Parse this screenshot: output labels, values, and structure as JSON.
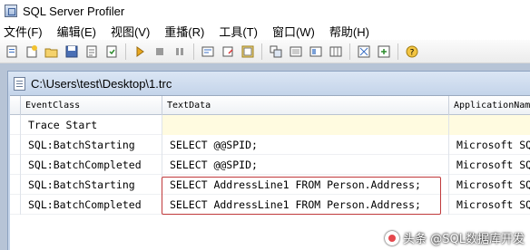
{
  "app": {
    "title": "SQL Server Profiler",
    "icon": "profiler-app-icon"
  },
  "menu": [
    {
      "label": "文件(F)"
    },
    {
      "label": "编辑(E)"
    },
    {
      "label": "视图(V)"
    },
    {
      "label": "重播(R)"
    },
    {
      "label": "工具(T)"
    },
    {
      "label": "窗口(W)"
    },
    {
      "label": "帮助(H)"
    }
  ],
  "toolbar": {
    "buttons": [
      "new-trace-icon",
      "new-template-icon",
      "open-icon",
      "save-icon",
      "properties-icon",
      "template-props-icon",
      "run-icon",
      "stop-icon",
      "pause-icon",
      "find-icon",
      "clear-icon",
      "extract-icon",
      "collapse-icon",
      "expand-icon",
      "group-icon",
      "columns-icon",
      "auto-scroll-icon",
      "settings-icon",
      "help-icon"
    ]
  },
  "trace_window": {
    "title": "C:\\Users\\test\\Desktop\\1.trc",
    "columns": [
      "EventClass",
      "TextData",
      "ApplicationNam"
    ],
    "rows": [
      {
        "event": "Trace Start",
        "text": "",
        "app": ""
      },
      {
        "event": "SQL:BatchStarting",
        "text": "SELECT @@SPID;",
        "app": "Microsoft SQ"
      },
      {
        "event": "SQL:BatchCompleted",
        "text": "SELECT @@SPID;",
        "app": "Microsoft SQ"
      },
      {
        "event": "SQL:BatchStarting",
        "text": "SELECT AddressLine1 FROM Person.Address;",
        "app": "Microsoft SQ"
      },
      {
        "event": "SQL:BatchCompleted",
        "text": "SELECT AddressLine1 FROM Person.Address;",
        "app": "Microsoft SQ"
      }
    ]
  },
  "colors": {
    "highlight_border": "#c0393b",
    "mdi_background": "#b7c4d6",
    "trace_start_cell": "#fffbe0"
  },
  "watermark": "头条 @SQL数据库开发"
}
